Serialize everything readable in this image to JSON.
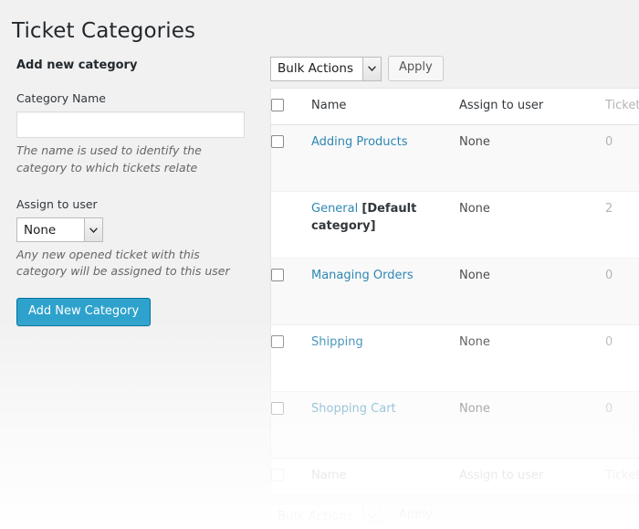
{
  "page": {
    "title": "Ticket Categories"
  },
  "form": {
    "heading": "Add new category",
    "name_label": "Category Name",
    "name_value": "",
    "name_placeholder": "",
    "name_hint": "The name is used to identify the category to which tickets relate",
    "assign_label": "Assign to user",
    "assign_value": "None",
    "assign_hint": "Any new opened ticket with this category will be assigned to this user",
    "submit_label": "Add New Category"
  },
  "tablenav": {
    "top": {
      "bulk_value": "Bulk Actions",
      "apply_label": "Apply"
    },
    "bottom": {
      "bulk_value": "Bulk Actions",
      "apply_label": "Apply"
    }
  },
  "table": {
    "columns": {
      "name": "Name",
      "assign": "Assign to user",
      "tickets": "Tickets"
    },
    "rows": [
      {
        "name": "Adding Products",
        "tag": "",
        "assign": "None",
        "tickets": "0",
        "has_checkbox": true
      },
      {
        "name": "General",
        "tag": "[Default category]",
        "assign": "None",
        "tickets": "2",
        "has_checkbox": false
      },
      {
        "name": "Managing Orders",
        "tag": "",
        "assign": "None",
        "tickets": "0",
        "has_checkbox": true
      },
      {
        "name": "Shipping",
        "tag": "",
        "assign": "None",
        "tickets": "0",
        "has_checkbox": true
      },
      {
        "name": "Shopping Cart",
        "tag": "",
        "assign": "None",
        "tickets": "0",
        "has_checkbox": true
      }
    ]
  },
  "colors": {
    "accent": "#2ea2cc",
    "link": "#2e87b3",
    "page_bg": "#f1f1f1",
    "row_alt": "#f9f9f9"
  }
}
